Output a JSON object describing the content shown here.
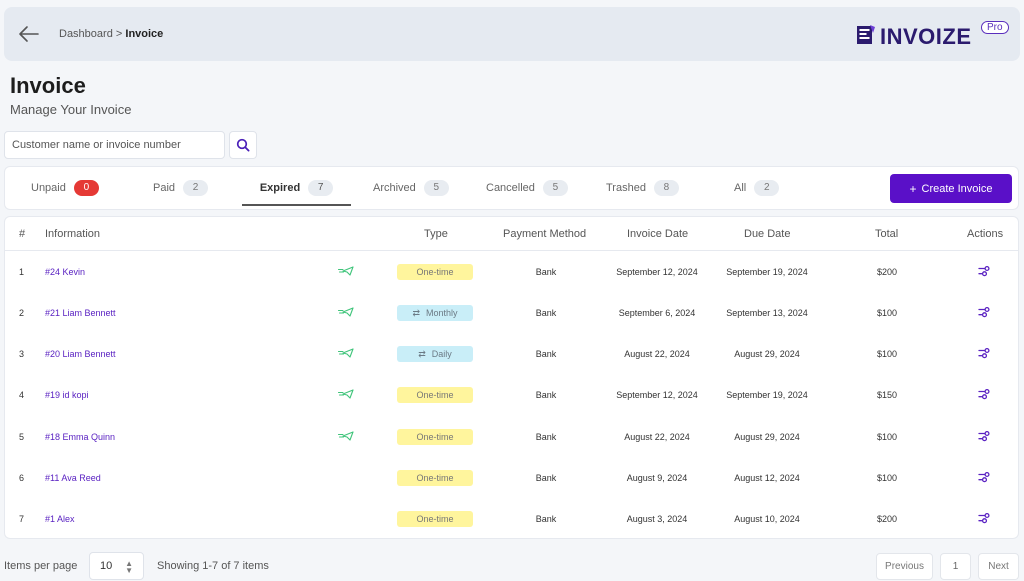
{
  "breadcrumb": {
    "parent": "Dashboard",
    "separator": ">",
    "current": "Invoice"
  },
  "logo": {
    "text": "INVOIZE",
    "badge": "Pro",
    "icon": "invoice-doc-icon"
  },
  "page": {
    "title": "Invoice",
    "subtitle": "Manage Your Invoice"
  },
  "search": {
    "placeholder": "Customer name or invoice number",
    "value": ""
  },
  "tabs": [
    {
      "label": "Unpaid",
      "count": "0"
    },
    {
      "label": "Paid",
      "count": "2"
    },
    {
      "label": "Expired",
      "count": "7"
    },
    {
      "label": "Archived",
      "count": "5"
    },
    {
      "label": "Cancelled",
      "count": "5"
    },
    {
      "label": "Trashed",
      "count": "8"
    },
    {
      "label": "All",
      "count": "2"
    }
  ],
  "active_tab": "Expired",
  "create_button": {
    "label": "Create Invoice",
    "icon": "plus-icon"
  },
  "table": {
    "headers": {
      "index": "#",
      "information": "Information",
      "type": "Type",
      "payment_method": "Payment Method",
      "invoice_date": "Invoice Date",
      "due_date": "Due Date",
      "total": "Total",
      "actions": "Actions"
    },
    "rows": [
      {
        "index": "1",
        "info": "#24 Kevin",
        "sent": true,
        "type": "One-time",
        "recurring": false,
        "method": "Bank",
        "invoice_date": "September 12, 2024",
        "due_date": "September 19, 2024",
        "total": "$200"
      },
      {
        "index": "2",
        "info": "#21 Liam Bennett",
        "sent": true,
        "type": "Monthly",
        "recurring": true,
        "method": "Bank",
        "invoice_date": "September 6, 2024",
        "due_date": "September 13, 2024",
        "total": "$100"
      },
      {
        "index": "3",
        "info": "#20 Liam Bennett",
        "sent": true,
        "type": "Daily",
        "recurring": true,
        "method": "Bank",
        "invoice_date": "August 22, 2024",
        "due_date": "August 29, 2024",
        "total": "$100"
      },
      {
        "index": "4",
        "info": "#19 id kopi",
        "sent": true,
        "type": "One-time",
        "recurring": false,
        "method": "Bank",
        "invoice_date": "September 12, 2024",
        "due_date": "September 19, 2024",
        "total": "$150"
      },
      {
        "index": "5",
        "info": "#18 Emma Quinn",
        "sent": true,
        "type": "One-time",
        "recurring": false,
        "method": "Bank",
        "invoice_date": "August 22, 2024",
        "due_date": "August 29, 2024",
        "total": "$100"
      },
      {
        "index": "6",
        "info": "#11 Ava Reed",
        "sent": false,
        "type": "One-time",
        "recurring": false,
        "method": "Bank",
        "invoice_date": "August 9, 2024",
        "due_date": "August 12, 2024",
        "total": "$100"
      },
      {
        "index": "7",
        "info": "#1 Alex",
        "sent": false,
        "type": "One-time",
        "recurring": false,
        "method": "Bank",
        "invoice_date": "August 3, 2024",
        "due_date": "August 10, 2024",
        "total": "$200"
      }
    ]
  },
  "footer": {
    "items_per_page_label": "Items per page",
    "items_per_page": "10",
    "showing": "Showing 1-7 of 7 items",
    "previous": "Previous",
    "current_page": "1",
    "next": "Next"
  },
  "colors": {
    "accent": "#5a10c8",
    "link": "#5a22c2",
    "unpaid_badge": "#e53935",
    "one_time_badge": "#fff59d",
    "recurring_badge": "#c9eef8",
    "sent_icon": "#3fc47a"
  }
}
